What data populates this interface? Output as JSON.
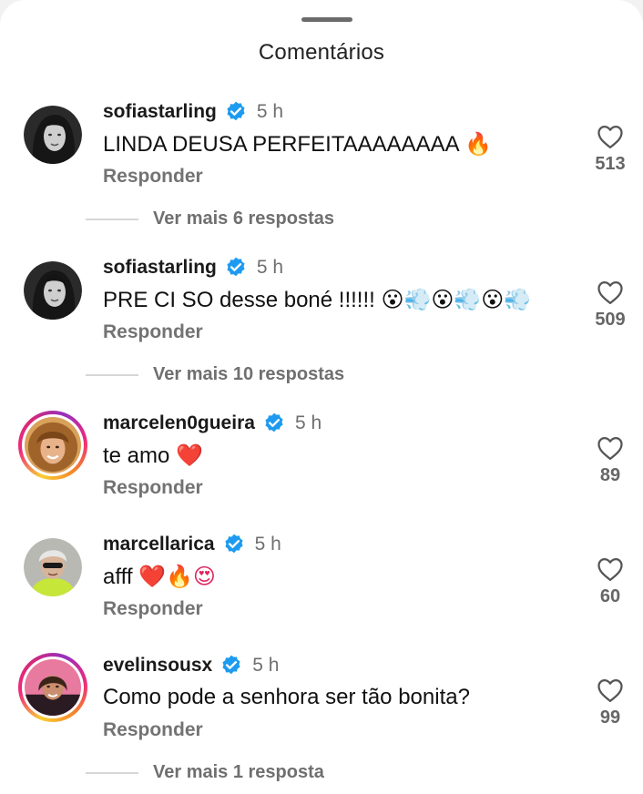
{
  "sheet": {
    "title": "Comentários"
  },
  "comments": [
    {
      "username": "sofiastarling",
      "time": "5 h",
      "text": "LINDA DEUSA PERFEITAAAAAAAA",
      "emojis": "🔥",
      "reply_label": "Responder",
      "likes": "513",
      "more_replies": "Ver mais 6 respostas"
    },
    {
      "username": "sofiastarling",
      "time": "5 h",
      "text": "PRE CI SO desse boné !!!!!!",
      "emojis": "😮💨😮💨😮💨",
      "reply_label": "Responder",
      "likes": "509",
      "more_replies": "Ver mais 10 respostas"
    },
    {
      "username": "marcelen0gueira",
      "time": "5 h",
      "text": "te amo",
      "emojis": "❤️",
      "reply_label": "Responder",
      "likes": "89"
    },
    {
      "username": "marcellarica",
      "time": "5 h",
      "text": "afff",
      "emojis": "❤️🔥😍",
      "reply_label": "Responder",
      "likes": "60"
    },
    {
      "username": "evelinsousx",
      "time": "5 h",
      "text": "Como pode a senhora ser tão bonita?",
      "emojis": "",
      "reply_label": "Responder",
      "likes": "99",
      "more_replies": "Ver mais 1 resposta"
    }
  ],
  "colors": {
    "verified": "#1d9bf0",
    "story_ring": "#ee2a7b"
  },
  "icons": {
    "verified": "verified-badge-icon",
    "like": "heart-outline-icon"
  }
}
